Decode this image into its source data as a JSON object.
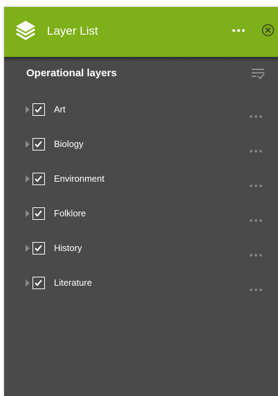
{
  "colors": {
    "header_bg": "#7eb01a",
    "panel_bg": "#4a4a4a",
    "text": "#ffffff",
    "muted_icon": "#8a8a8a"
  },
  "header": {
    "icon": "layers-icon",
    "title": "Layer List",
    "menu_icon": "more-horizontal-icon",
    "close_icon": "close-circle-icon"
  },
  "section": {
    "title": "Operational layers",
    "options_icon": "list-check-icon"
  },
  "layers": [
    {
      "label": "Art",
      "checked": true
    },
    {
      "label": "Biology",
      "checked": true
    },
    {
      "label": "Environment",
      "checked": true
    },
    {
      "label": "Folklore",
      "checked": true
    },
    {
      "label": "History",
      "checked": true
    },
    {
      "label": "Literature",
      "checked": true
    }
  ]
}
